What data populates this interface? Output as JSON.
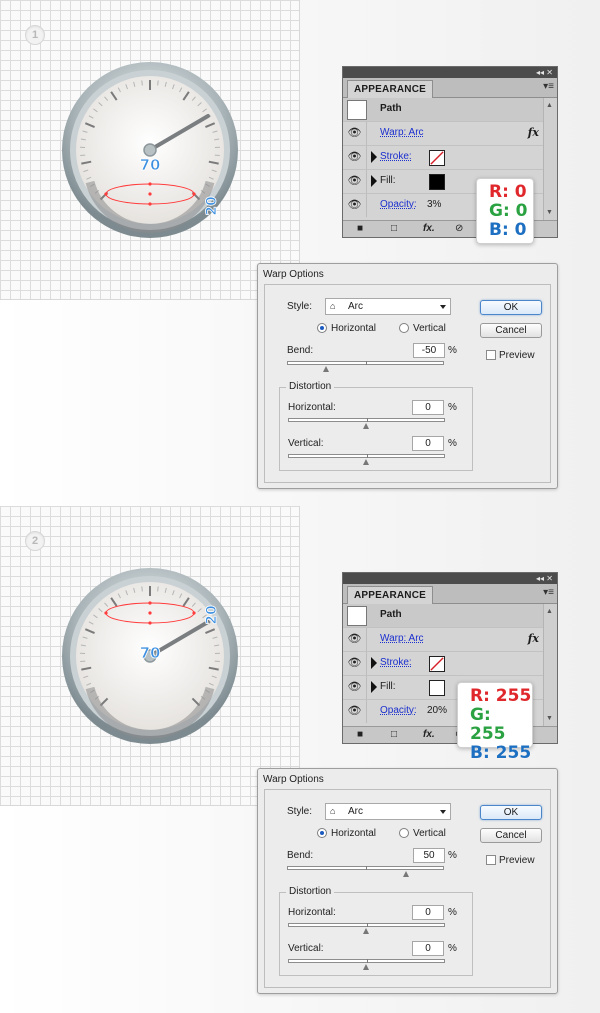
{
  "steps": [
    {
      "number": "1",
      "gauge": {
        "label_big": "70",
        "label_small": "20"
      },
      "appearance": {
        "tab": "APPEARANCE",
        "path_label": "Path",
        "warp_label": "Warp: Arc",
        "stroke_label": "Stroke:",
        "fill_label": "Fill:",
        "opacity_label": "Opacity:",
        "opacity_value": "3%",
        "fill_color": "#000000",
        "fx": "fx"
      },
      "rgb": {
        "r": "R: 0",
        "g": "G: 0",
        "b": "B: 0"
      },
      "warp": {
        "title": "Warp Options",
        "style_label": "Style:",
        "style_value": "Arc",
        "horizontal_label": "Horizontal",
        "vertical_label": "Vertical",
        "bend_label": "Bend:",
        "bend_value": "-50",
        "percent": "%",
        "distortion_label": "Distortion",
        "dist_horizontal_label": "Horizontal:",
        "dist_horizontal_value": "0",
        "dist_vertical_label": "Vertical:",
        "dist_vertical_value": "0",
        "ok_label": "OK",
        "cancel_label": "Cancel",
        "preview_label": "Preview"
      }
    },
    {
      "number": "2",
      "gauge": {
        "label_big": "70",
        "label_small": "20"
      },
      "appearance": {
        "tab": "APPEARANCE",
        "path_label": "Path",
        "warp_label": "Warp: Arc",
        "stroke_label": "Stroke:",
        "fill_label": "Fill:",
        "opacity_label": "Opacity:",
        "opacity_value": "20%",
        "fill_color": "#ffffff",
        "fx": "fx"
      },
      "rgb": {
        "r": "R: 255",
        "g": "G: 255",
        "b": "B: 255"
      },
      "warp": {
        "title": "Warp Options",
        "style_label": "Style:",
        "style_value": "Arc",
        "horizontal_label": "Horizontal",
        "vertical_label": "Vertical",
        "bend_label": "Bend:",
        "bend_value": "50",
        "percent": "%",
        "distortion_label": "Distortion",
        "dist_horizontal_label": "Horizontal:",
        "dist_horizontal_value": "0",
        "dist_vertical_label": "Vertical:",
        "dist_vertical_value": "0",
        "ok_label": "OK",
        "cancel_label": "Cancel",
        "preview_label": "Preview"
      }
    }
  ],
  "colors": {
    "red": "#e0272c",
    "green": "#2aa241",
    "blue": "#1d6fc1",
    "label_blue": "#3c8fe0"
  },
  "icons": [
    "eye-icon",
    "stroke-none-swatch",
    "fx-icon",
    "panel-menu-icon",
    "arc-style-icon",
    "new-item-icon",
    "clear-icon"
  ]
}
